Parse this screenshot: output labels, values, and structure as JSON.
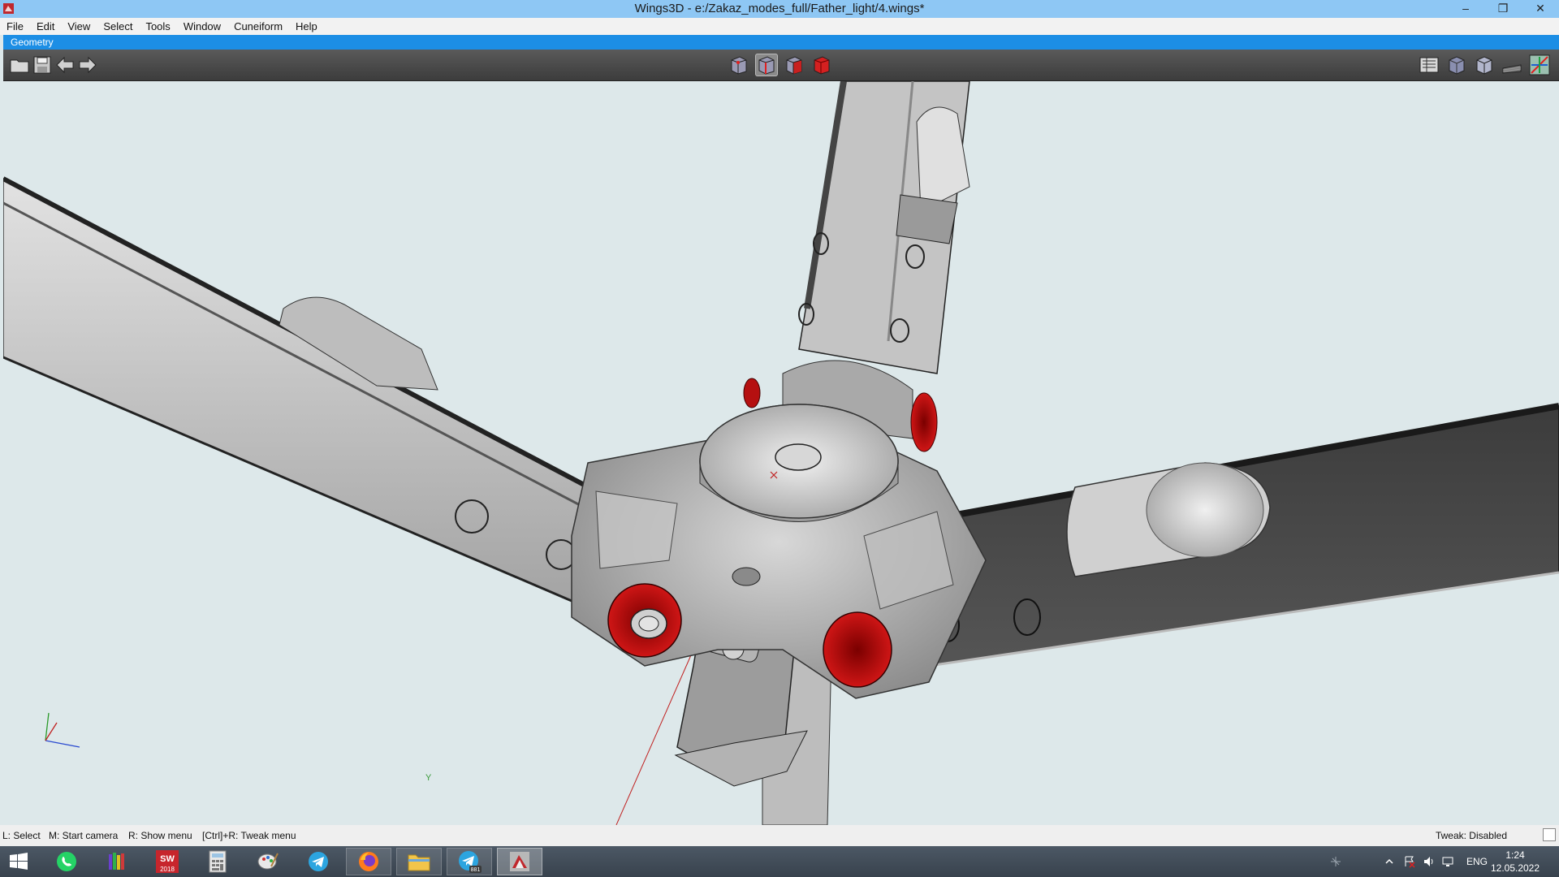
{
  "window": {
    "title": "Wings3D - e:/Zakaz_modes_full/Father_light/4.wings*",
    "min_symbol": "–",
    "restore_symbol": "❐",
    "close_symbol": "✕"
  },
  "menu": [
    "File",
    "Edit",
    "View",
    "Select",
    "Tools",
    "Window",
    "Cuneiform",
    "Help"
  ],
  "geometry_tab": "Geometry",
  "toolbar": {
    "left_icons": [
      "open-folder-icon",
      "save-icon",
      "undo-arrow-icon",
      "redo-arrow-icon"
    ],
    "select_modes": [
      "vertex-mode-icon",
      "edge-mode-icon",
      "face-mode-icon",
      "body-mode-icon"
    ],
    "active_select_mode": "edge-mode-icon",
    "right_icons": [
      "groundplane-icon",
      "smooth-shade-icon",
      "wireframe-icon",
      "shadow-icon",
      "axes-icon"
    ]
  },
  "viewport": {
    "axis_y_label": "Y",
    "origin_marker": "x",
    "colors": {
      "background": "#dde8ea",
      "accent_red": "#b51010",
      "panel_dark": "#4a4a4a"
    }
  },
  "status": {
    "hint_select": "L: Select",
    "hint_camera": "M: Start camera",
    "hint_menu": "R: Show menu",
    "hint_tweak": "[Ctrl]+R: Tweak menu",
    "tweak_state": "Tweak: Disabled"
  },
  "taskbar": {
    "apps": [
      {
        "name": "start-button",
        "label": ""
      },
      {
        "name": "whatsapp-icon",
        "label": ""
      },
      {
        "name": "library-icon",
        "label": ""
      },
      {
        "name": "solidworks-icon",
        "label": "2018"
      },
      {
        "name": "calculator-icon",
        "label": ""
      },
      {
        "name": "paint-icon",
        "label": ""
      },
      {
        "name": "telegram-icon",
        "label": ""
      },
      {
        "name": "firefox-icon",
        "label": ""
      },
      {
        "name": "file-explorer-icon",
        "label": ""
      },
      {
        "name": "telegram-badge-icon",
        "label": "881"
      },
      {
        "name": "wings3d-icon",
        "label": ""
      }
    ],
    "language": "ENG",
    "time": "1:24",
    "date": "12.05.2022"
  }
}
